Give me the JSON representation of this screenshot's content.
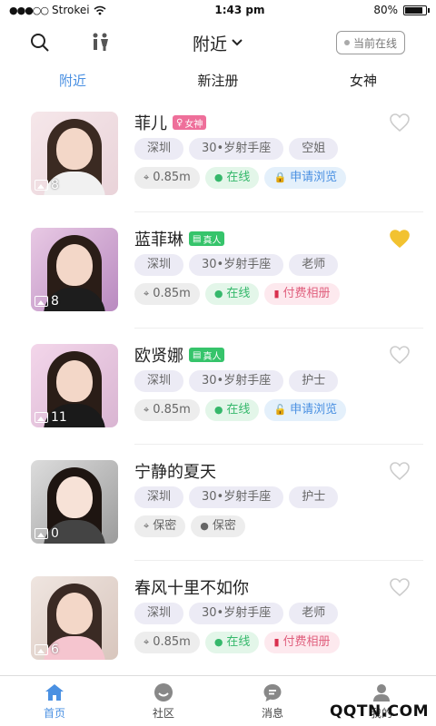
{
  "status": {
    "carrier": "Strokei",
    "time": "1:43 pm",
    "battery": "80%"
  },
  "header": {
    "title": "附近",
    "online_button": "当前在线"
  },
  "tabs": [
    {
      "label": "附近",
      "active": true
    },
    {
      "label": "新注册",
      "active": false
    },
    {
      "label": "女神",
      "active": false
    }
  ],
  "users": [
    {
      "name": "菲儿",
      "badge": "女神",
      "badge_type": "goddess",
      "photos": "8",
      "liked": false,
      "tags": [
        "深圳",
        "30•岁射手座",
        "空姐"
      ],
      "info": [
        {
          "text": "0.85m",
          "style": "gray",
          "icon": "location-icon"
        },
        {
          "text": "在线",
          "style": "green",
          "icon": "person-icon"
        },
        {
          "text": "申请浏览",
          "style": "blue",
          "icon": "lock-icon"
        }
      ]
    },
    {
      "name": "蓝菲琳",
      "badge": "真人",
      "badge_type": "real",
      "photos": "8",
      "liked": true,
      "tags": [
        "深圳",
        "30•岁射手座",
        "老师"
      ],
      "info": [
        {
          "text": "0.85m",
          "style": "gray",
          "icon": "location-icon"
        },
        {
          "text": "在线",
          "style": "green",
          "icon": "person-icon"
        },
        {
          "text": "付费相册",
          "style": "pink",
          "icon": "red-envelope-icon"
        }
      ]
    },
    {
      "name": "欧贤娜",
      "badge": "真人",
      "badge_type": "real",
      "photos": "11",
      "liked": false,
      "tags": [
        "深圳",
        "30•岁射手座",
        "护士"
      ],
      "info": [
        {
          "text": "0.85m",
          "style": "gray",
          "icon": "location-icon"
        },
        {
          "text": "在线",
          "style": "green",
          "icon": "person-icon"
        },
        {
          "text": "申请浏览",
          "style": "blue",
          "icon": "unlock-icon"
        }
      ]
    },
    {
      "name": "宁静的夏天",
      "badge": "",
      "badge_type": "",
      "photos": "0",
      "liked": false,
      "tags": [
        "深圳",
        "30•岁射手座",
        "护士"
      ],
      "info": [
        {
          "text": "保密",
          "style": "gray",
          "icon": "location-icon"
        },
        {
          "text": "保密",
          "style": "gray",
          "icon": "person-icon"
        }
      ]
    },
    {
      "name": "春风十里不如你",
      "badge": "",
      "badge_type": "",
      "photos": "6",
      "liked": false,
      "tags": [
        "深圳",
        "30•岁射手座",
        "老师"
      ],
      "info": [
        {
          "text": "0.85m",
          "style": "gray",
          "icon": "location-icon"
        },
        {
          "text": "在线",
          "style": "green",
          "icon": "person-icon"
        },
        {
          "text": "付费相册",
          "style": "pink",
          "icon": "red-envelope-icon"
        }
      ]
    }
  ],
  "nav": [
    {
      "label": "首页",
      "icon": "home-icon",
      "active": true
    },
    {
      "label": "社区",
      "icon": "community-icon",
      "active": false
    },
    {
      "label": "消息",
      "icon": "message-icon",
      "active": false
    },
    {
      "label": "我的",
      "icon": "profile-icon",
      "active": false
    }
  ],
  "watermark": "QQTN.COM",
  "colors": {
    "accent": "#4a90e2",
    "liked_heart": "#f2c230"
  }
}
